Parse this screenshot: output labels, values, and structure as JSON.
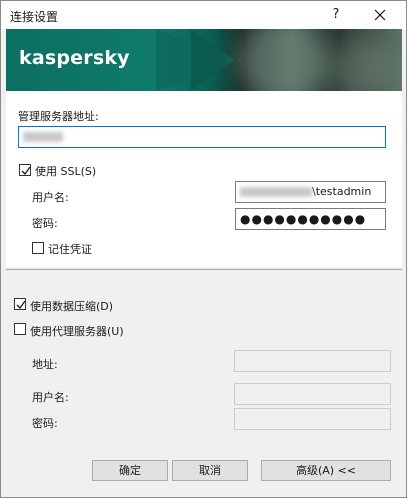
{
  "window": {
    "title": "连接设置",
    "help": "?"
  },
  "banner": {
    "logo": "kaspersky"
  },
  "server": {
    "label": "管理服务器地址:",
    "value": ""
  },
  "ssl": {
    "label": "使用 SSL(S)",
    "checked": true
  },
  "credentials": {
    "username_label": "用户名:",
    "username_suffix": "\\testadmin",
    "password_label": "密码:",
    "password_mask": "●●●●●●●●●●●",
    "remember_label": "记住凭证",
    "remember_checked": false
  },
  "compression": {
    "label": "使用数据压缩(D)",
    "checked": true
  },
  "proxy": {
    "label": "使用代理服务器(U)",
    "checked": false,
    "address_label": "地址:",
    "username_label": "用户名:",
    "password_label": "密码:"
  },
  "buttons": {
    "ok": "确定",
    "cancel": "取消",
    "advanced": "高级(A) <<"
  }
}
